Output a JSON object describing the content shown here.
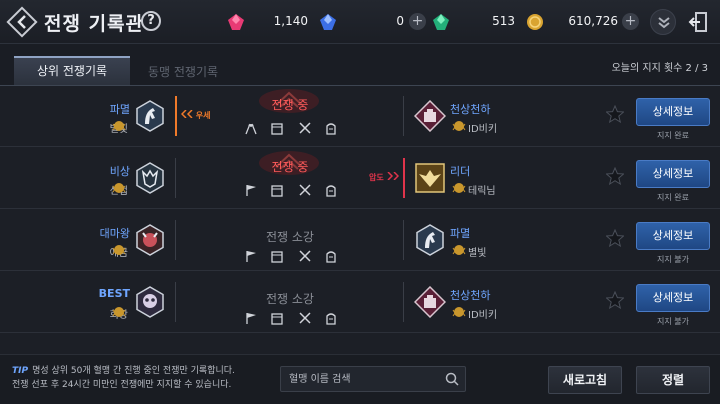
{
  "header": {
    "title": "전쟁 기록관",
    "help_label": "?",
    "currencies": [
      {
        "icon": "red-gem-icon",
        "value": "1,140"
      },
      {
        "icon": "blue-gem-icon",
        "value": "0"
      },
      {
        "icon": "green-gem-icon",
        "value": "513"
      },
      {
        "icon": "gold-coin-icon",
        "value": "610,726"
      }
    ]
  },
  "tabs": {
    "active": "상위 전쟁기록",
    "inactive": "동맹 전쟁기록",
    "support_count": "오늘의 지지 횟수 2 / 3"
  },
  "rows": [
    {
      "left_name": "파멸",
      "left_sub": "별빛",
      "left_badge": "우세",
      "status": "전쟁 중",
      "right_name": "천상천하",
      "right_sub": "ID비키",
      "right_badge": "",
      "detail_label": "상세정보",
      "detail_sub": "지지 완료"
    },
    {
      "left_name": "비상",
      "left_sub": "신법",
      "left_badge": "",
      "status": "전쟁 중",
      "right_name": "리더",
      "right_sub": "테릭님",
      "right_badge": "압도",
      "detail_label": "상세정보",
      "detail_sub": "지지 완료"
    },
    {
      "left_name": "대마왕",
      "left_sub": "애금",
      "left_badge": "",
      "status": "전쟁 소강",
      "right_name": "파멸",
      "right_sub": "별빛",
      "right_badge": "",
      "detail_label": "상세정보",
      "detail_sub": "지지 불가"
    },
    {
      "left_name": "BEST",
      "left_sub": "회장",
      "left_badge": "",
      "status": "전쟁 소강",
      "right_name": "천상천하",
      "right_sub": "ID비키",
      "right_badge": "",
      "detail_label": "상세정보",
      "detail_sub": "지지 불가"
    }
  ],
  "footer": {
    "tip_label": "TIP",
    "tip_line1": "명성 상위 50개 혈맹 간 진행 중인 전쟁만 기록합니다.",
    "tip_line2": "전쟁 선포 후 24시간 미만인 전쟁에만 지지할 수 있습니다.",
    "search_placeholder": "혈맹 이름 검색",
    "refresh_label": "새로고침",
    "sort_label": "정렬"
  },
  "colors": {
    "clan_name": "#6fa6ff",
    "war_active": "#ff5a5a",
    "advantage": "#f07a2a",
    "dominant": "#e0344b",
    "detail_button": "#2f62a9"
  }
}
